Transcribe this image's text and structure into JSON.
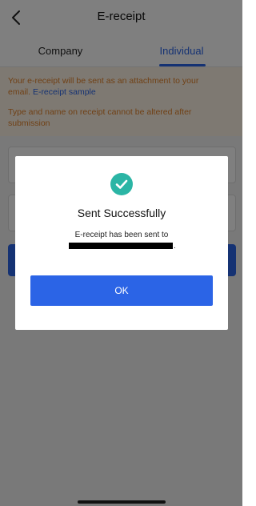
{
  "header": {
    "title": "E-receipt",
    "back_icon": "chevron-left-icon"
  },
  "tabs": [
    {
      "label": "Company",
      "active": false
    },
    {
      "label": "Individual",
      "active": true
    }
  ],
  "notice": {
    "line1": "Your e-receipt will be sent as an attachment to your",
    "line2_prefix": "email.",
    "line2_link": "E-receipt sample",
    "line3": "Type and name on receipt cannot be altered after",
    "line4": "submission"
  },
  "modal": {
    "icon": "check-circle-icon",
    "title": "Sent Successfully",
    "message": "E-receipt has been sent to",
    "message_suffix": ".",
    "ok_label": "OK"
  },
  "colors": {
    "accent": "#2b64e6",
    "success": "#2bb5a5",
    "notice_text": "#e0812a",
    "notice_bg": "#fdf3e4"
  }
}
